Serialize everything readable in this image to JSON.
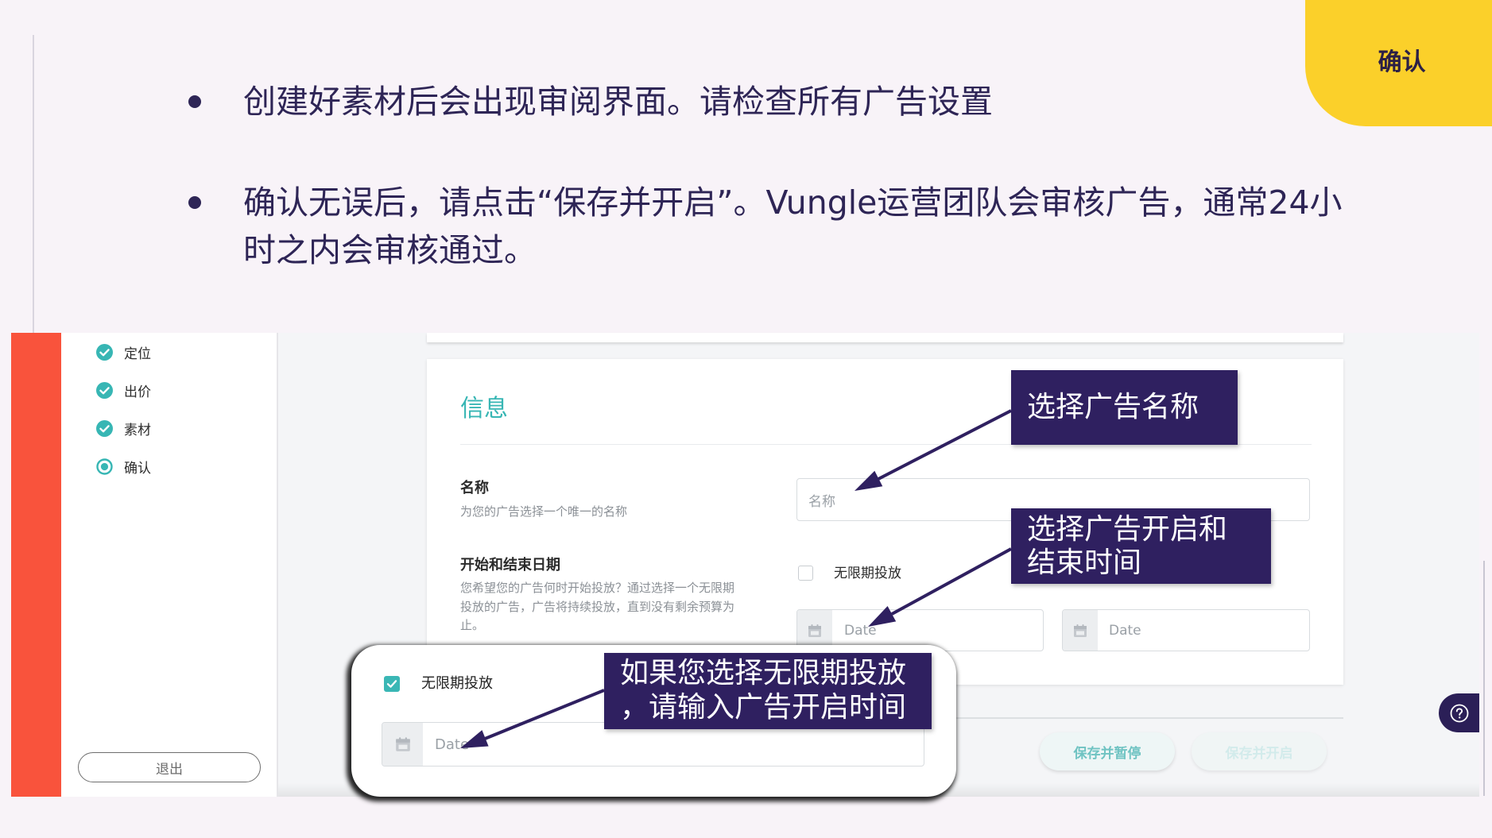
{
  "slide": {
    "confirm_tab": "确认",
    "bullets": [
      {
        "lines": [
          "创建好素材后会出现审阅界面。请检查所有广告设置"
        ]
      },
      {
        "lines": [
          "确认无误后，请点击“保存并开启”。Vungle运营团队会审核广告，通常24小",
          "时之内会审核通过。"
        ]
      }
    ]
  },
  "sidebar": {
    "items": [
      {
        "label": "定位",
        "icon": "check-circle-icon",
        "completed": true
      },
      {
        "label": "出价",
        "icon": "check-circle-icon",
        "completed": true
      },
      {
        "label": "素材",
        "icon": "check-circle-icon",
        "completed": true
      },
      {
        "label": "确认",
        "icon": "radio-selected-icon",
        "completed": false,
        "current": true
      }
    ],
    "logout_label": "退出"
  },
  "info_card": {
    "title": "信息",
    "name_label": "名称",
    "name_help": "为您的广告选择一个唯一的名称",
    "name_placeholder": "名称",
    "dates_label": "开始和结束日期",
    "dates_help_lines": [
      "您希望您的广告何时开始投放？通过选择一个无限期",
      "投放的广告，广告将持续投放，直到没有剩余预算为",
      "止。"
    ],
    "indefinite_label": "无限期投放",
    "indefinite_checked": false,
    "start_date_placeholder": "Date",
    "end_date_placeholder": "Date"
  },
  "actions": {
    "save_pause": "保存并暂停",
    "save_start": "保存并开启"
  },
  "zoom_popup": {
    "indefinite_label": "无限期投放",
    "indefinite_checked": true,
    "date_placeholder": "Date"
  },
  "callouts": [
    {
      "lines": [
        "选择广告名称"
      ]
    },
    {
      "lines": [
        "选择广告开启和",
        "结束时间"
      ]
    },
    {
      "lines": [
        "如果您选择无限期投放",
        "，请输入广告开启时间"
      ]
    }
  ],
  "icons": {
    "help": "help-circle-icon",
    "calendar": "calendar-icon",
    "bullet": "bullet-dot-icon"
  },
  "colors": {
    "slide_background": "#f8f3f8",
    "slide_text": "#2e2556",
    "tab_yellow": "#fbd02a",
    "brand_red": "#f9533c",
    "accent_teal": "#37b6b4",
    "callout_purple": "#2f2060",
    "app_background": "#f4f5f7"
  }
}
